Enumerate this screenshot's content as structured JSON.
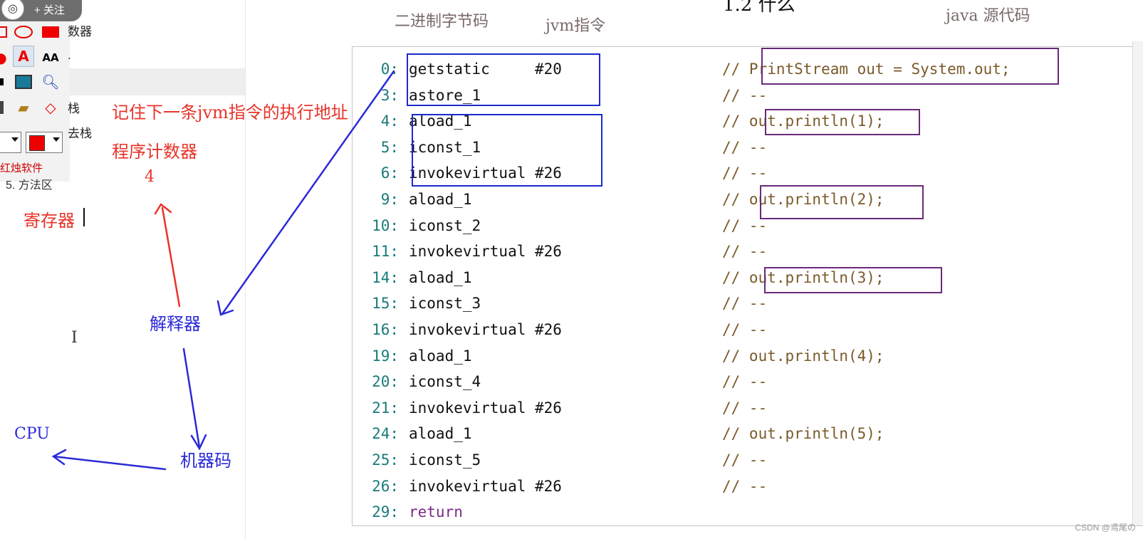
{
  "follow": {
    "label": "+ 关注",
    "logo": "黑马程序员"
  },
  "left_panel": {
    "clipped_labels": [
      "数器",
      "栈",
      "去栈",
      "."
    ],
    "brand": "红烛软件",
    "area5": "5. 方法区"
  },
  "toolbar_icons": [
    "rectangle-icon",
    "ellipse-icon",
    "filled-rect-icon",
    "shape-icon",
    "text-icon",
    "font-size-icon",
    "pen-icon",
    "screen-icon",
    "magnifier-icon",
    "book-icon",
    "open-folder-icon",
    "diamond-icon"
  ],
  "annotations": {
    "remember_next": "记住下一条jvm指令的执行地址",
    "program_counter": "程序计数器",
    "pc_value": "4",
    "register": "寄存器",
    "interpreter": "解释器",
    "machine_code": "机器码",
    "cpu": "CPU"
  },
  "titles": {
    "bytecode": "二进制字节码",
    "jvm_instructions": "jvm指令",
    "java_source": "java 源代码",
    "top_cut": "1.2 什么"
  },
  "code": [
    {
      "offset": "0:",
      "ins": "getstatic     #20",
      "comment": "// PrintStream out = System.out;"
    },
    {
      "offset": "3:",
      "ins": "astore_1",
      "comment": "// --"
    },
    {
      "offset": "4:",
      "ins": "aload_1",
      "comment": "// out.println(1);"
    },
    {
      "offset": "5:",
      "ins": "iconst_1",
      "comment": "// --"
    },
    {
      "offset": "6:",
      "ins": "invokevirtual #26",
      "comment": "// --"
    },
    {
      "offset": "9:",
      "ins": "aload_1",
      "comment": "// out.println(2);"
    },
    {
      "offset": "10:",
      "ins": "iconst_2",
      "comment": "// --"
    },
    {
      "offset": "11:",
      "ins": "invokevirtual #26",
      "comment": "// --"
    },
    {
      "offset": "14:",
      "ins": "aload_1",
      "comment": "// out.println(3);"
    },
    {
      "offset": "15:",
      "ins": "iconst_3",
      "comment": "// --"
    },
    {
      "offset": "16:",
      "ins": "invokevirtual #26",
      "comment": "// --"
    },
    {
      "offset": "19:",
      "ins": "aload_1",
      "comment": "// out.println(4);"
    },
    {
      "offset": "20:",
      "ins": "iconst_4",
      "comment": "// --"
    },
    {
      "offset": "21:",
      "ins": "invokevirtual #26",
      "comment": "// --"
    },
    {
      "offset": "24:",
      "ins": "aload_1",
      "comment": "// out.println(5);"
    },
    {
      "offset": "25:",
      "ins": "iconst_5",
      "comment": "// --"
    },
    {
      "offset": "26:",
      "ins": "invokevirtual #26",
      "comment": "// --"
    },
    {
      "offset": "29:",
      "ins": "return",
      "comment": ""
    }
  ],
  "watermark": "CSDN @鸢尾の",
  "colors": {
    "annotation_red": "#e8342a",
    "annotation_blue": "#2a2ad8",
    "box_blue": "#1a2ccc",
    "box_purple": "#6a2a7a"
  }
}
